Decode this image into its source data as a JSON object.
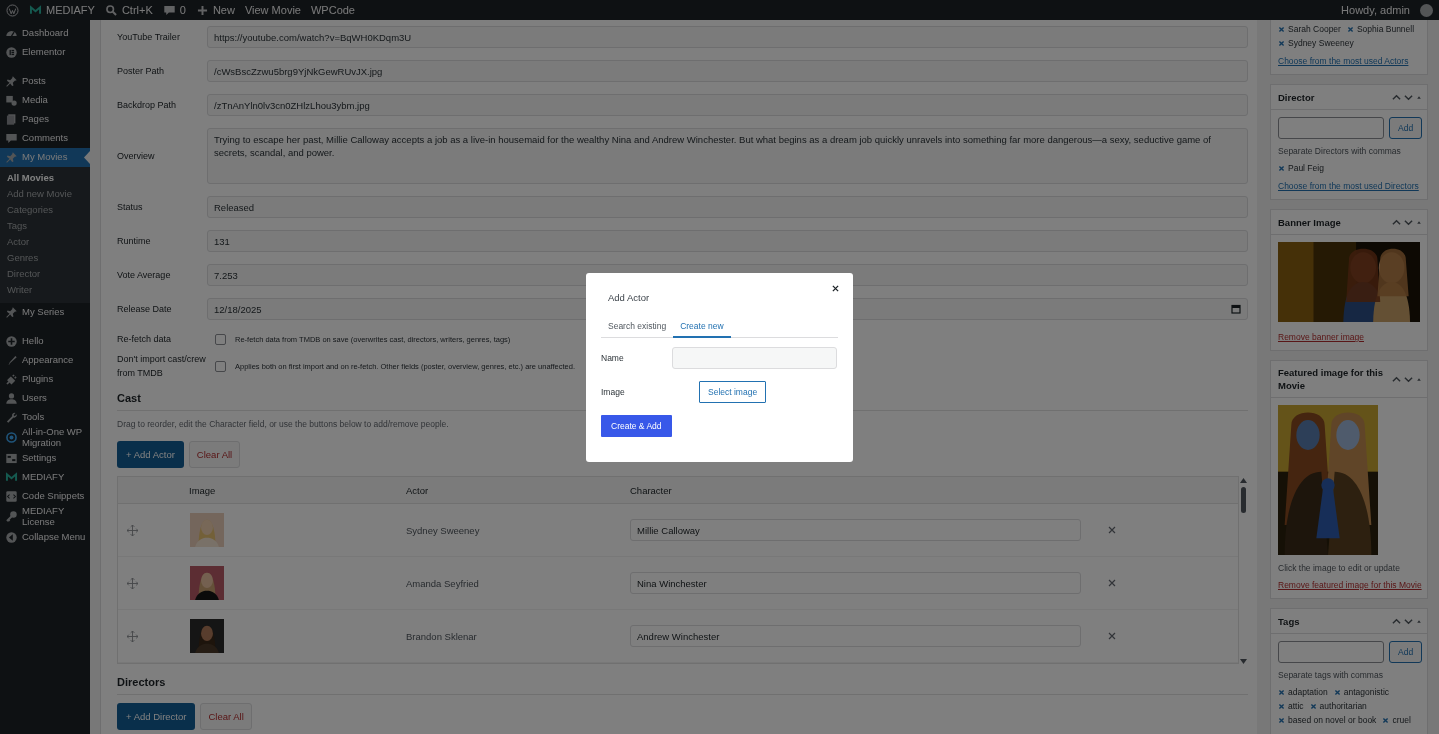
{
  "admin_bar": {
    "site": "MEDIAFY",
    "search_shortcut": "Ctrl+K",
    "comments": "0",
    "new": "New",
    "links": [
      "View Movie",
      "WPCode"
    ],
    "greeting": "Howdy, admin"
  },
  "sidebar": {
    "groups": [
      [
        {
          "label": "Dashboard",
          "selected": false
        },
        {
          "label": "Elementor",
          "selected": false
        }
      ],
      [
        {
          "label": "Posts",
          "selected": false
        },
        {
          "label": "Media",
          "selected": false
        },
        {
          "label": "Pages",
          "selected": false
        },
        {
          "label": "Comments",
          "selected": false
        },
        {
          "label": "My Movies",
          "selected": true,
          "children": [
            {
              "label": "All Movies",
              "selected": true
            },
            {
              "label": "Add new Movie",
              "selected": false
            },
            {
              "label": "Categories",
              "selected": false
            },
            {
              "label": "Tags",
              "selected": false
            },
            {
              "label": "Actor",
              "selected": false
            },
            {
              "label": "Genres",
              "selected": false
            },
            {
              "label": "Director",
              "selected": false
            },
            {
              "label": "Writer",
              "selected": false
            }
          ]
        },
        {
          "label": "My Series",
          "selected": false
        }
      ],
      [
        {
          "label": "Hello",
          "selected": false
        },
        {
          "label": "Appearance",
          "selected": false
        },
        {
          "label": "Plugins",
          "selected": false
        },
        {
          "label": "Users",
          "selected": false
        },
        {
          "label": "Tools",
          "selected": false
        },
        {
          "label": "All-in-One WP Migration",
          "selected": false
        },
        {
          "label": "Settings",
          "selected": false
        },
        {
          "label": "MEDIAFY",
          "selected": false
        },
        {
          "label": "Code Snippets",
          "selected": false
        },
        {
          "label": "MEDIAFY License",
          "selected": false
        },
        {
          "label": "Collapse Menu",
          "selected": false
        }
      ]
    ]
  },
  "fields": [
    {
      "kind": "text",
      "label": "YouTube Trailer",
      "value": "https://youtube.com/watch?v=BqWH0KDqm3U"
    },
    {
      "kind": "text",
      "label": "Poster Path",
      "value": "/cWsBscZzwu5brg9YjNkGewRUvJX.jpg"
    },
    {
      "kind": "text",
      "label": "Backdrop Path",
      "value": "/zTnAnYln0lv3cn0ZHlzLhou3ybm.jpg"
    },
    {
      "kind": "textarea",
      "label": "Overview",
      "value": "Trying to escape her past, Millie Calloway accepts a job as a live-in housemaid for the wealthy Nina and Andrew Winchester. But what begins as a dream job quickly unravels into something far more dangerous—a sexy, seductive game of secrets, scandal, and power."
    },
    {
      "kind": "text",
      "label": "Status",
      "value": "Released"
    },
    {
      "kind": "text",
      "label": "Runtime",
      "value": "131"
    },
    {
      "kind": "text",
      "label": "Vote Average",
      "value": "7.253"
    },
    {
      "kind": "date",
      "label": "Release Date",
      "value": "12/18/2025"
    },
    {
      "kind": "checkbox",
      "label": "Re-fetch data",
      "checked": false,
      "text": "Re-fetch data from TMDB on save (overwrites cast, directors, writers, genres, tags)"
    },
    {
      "kind": "checkbox",
      "label": "Don't import cast/crew from TMDB",
      "checked": false,
      "text": "Applies both on first import and on re-fetch. Other fields (poster, overview, genres, etc.) are unaffected."
    }
  ],
  "cast": {
    "title": "Cast",
    "hint": "Drag to reorder, edit the Character field, or use the buttons below to add/remove people.",
    "add_button": "+ Add Actor",
    "clear_button": "Clear All",
    "columns": [
      "Image",
      "Actor",
      "Character"
    ],
    "rows": [
      {
        "actor": "Sydney Sweeney",
        "character": "Millie Calloway"
      },
      {
        "actor": "Amanda Seyfried",
        "character": "Nina Winchester"
      },
      {
        "actor": "Brandon Sklenar",
        "character": "Andrew Winchester"
      }
    ]
  },
  "directors": {
    "title": "Directors",
    "add_button": "+ Add Director",
    "clear_button": "Clear All"
  },
  "side_panels": [
    {
      "kind": "terms",
      "tags": [
        "Sarah Cooper",
        "Sophia Bunnell",
        "Sydney Sweeney"
      ],
      "link": "Choose from the most used Actors"
    },
    {
      "kind": "terms",
      "title": "Director",
      "add_button": "Add",
      "hint": "Separate Directors with commas",
      "tags": [
        "Paul Feig"
      ],
      "link": "Choose from the most used Directors"
    },
    {
      "title": "Banner Image",
      "link": "Remove banner image"
    },
    {
      "title": "Featured image for this Movie",
      "hint": "Click the image to edit or update",
      "link": "Remove featured image for this Movie"
    },
    {
      "kind": "terms",
      "title": "Tags",
      "add_button": "Add",
      "hint": "Separate tags with commas",
      "tags": [
        "adaptation",
        "antagonistic",
        "attic",
        "authoritarian",
        "based on novel or book",
        "cruel"
      ]
    }
  ],
  "modal": {
    "open": true,
    "title": "Add Actor",
    "tabs": [
      {
        "label": "Search existing",
        "selected": false
      },
      {
        "label": "Create new",
        "selected": true
      }
    ],
    "name_label": "Name",
    "image_label": "Image",
    "select_button": "Select image",
    "submit_button": "Create & Add"
  }
}
